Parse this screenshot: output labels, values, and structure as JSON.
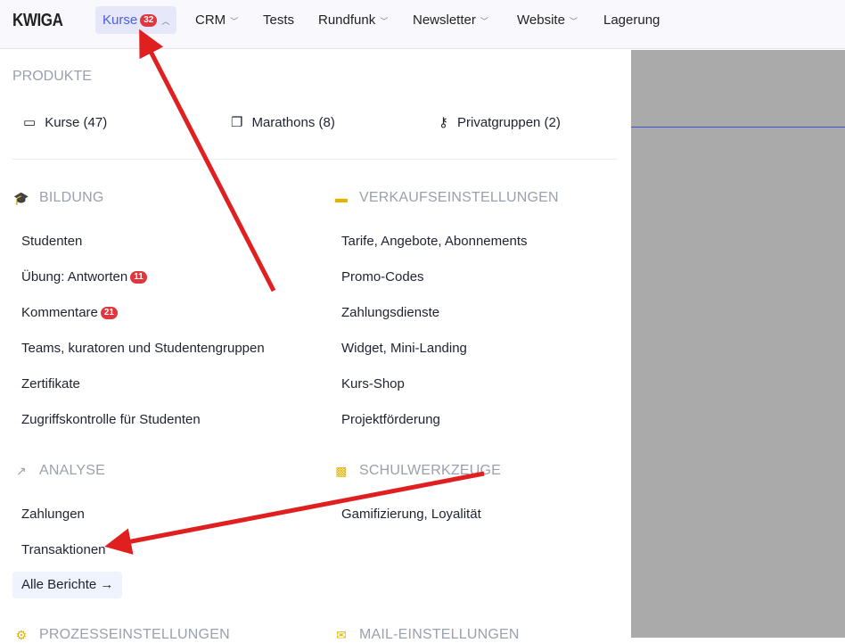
{
  "nav": {
    "logo": "KWIGA",
    "items": [
      {
        "label": "Kurse",
        "badge": "32"
      },
      {
        "label": "CRM"
      },
      {
        "label": "Tests"
      },
      {
        "label": "Rundfunk"
      },
      {
        "label": "Newsletter"
      },
      {
        "label": "Website"
      },
      {
        "label": "Lagerung"
      }
    ]
  },
  "produkte": {
    "title": "PRODUKTE",
    "items": [
      "Kurse (47)",
      "Marathons (8)",
      "Privatgruppen (2)"
    ]
  },
  "bildung": {
    "title": "BILDUNG",
    "items": [
      "Studenten",
      "Übung: Antworten",
      "Kommentare",
      "Teams, kuratoren und Studentengruppen",
      "Zertifikate",
      "Zugriffskontrolle für Studenten"
    ],
    "badges": {
      "answers": "11",
      "comments": "21"
    }
  },
  "verkauf": {
    "title": "VERKAUFSEINSTELLUNGEN",
    "items": [
      "Tarife, Angebote, Abonnements",
      "Promo-Codes",
      "Zahlungsdienste",
      "Widget, Mini-Landing",
      "Kurs-Shop",
      "Projektförderung"
    ]
  },
  "analyse": {
    "title": "ANALYSE",
    "items": [
      "Zahlungen",
      "Transaktionen"
    ],
    "all_reports": "Alle Berichte →"
  },
  "schul": {
    "title": "SCHULWERKZEUGE",
    "items": [
      "Gamifizierung, Loyalität"
    ]
  },
  "prozess": {
    "title": "PROZESSEINSTELLUNGEN"
  },
  "mail": {
    "title": "MAIL-EINSTELLUNGEN"
  },
  "colors": {
    "accent": "#4a5cf0",
    "badge": "#e0363d",
    "arrow": "#e02020",
    "icon": "#f2c500"
  }
}
